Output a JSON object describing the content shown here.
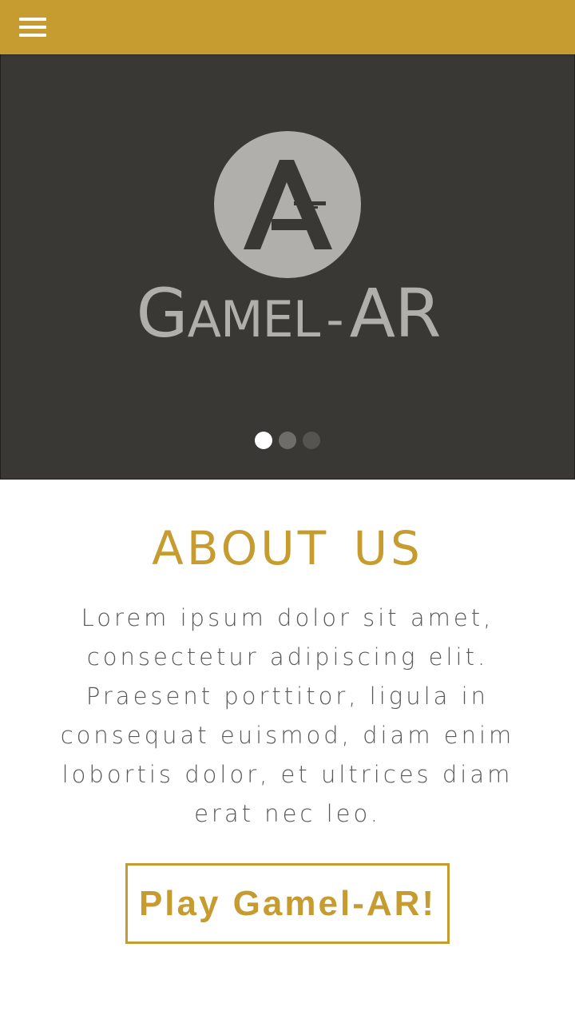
{
  "header": {
    "menu_icon": "hamburger-menu-icon",
    "background_color": "#c69c30"
  },
  "hero": {
    "logo_text_big_1": "G",
    "logo_text_small": "AMEL",
    "logo_text_dash": "-",
    "logo_text_big_2": "AR",
    "background_color": "#393834",
    "carousel": {
      "slide_count": 3,
      "active_index": 0
    }
  },
  "about": {
    "title": "ABOUT US",
    "body": "Lorem ipsum dolor sit amet, consectetur adipiscing elit. Praesent porttitor, ligula in consequat euismod, diam enim lobortis dolor, et ultrices diam erat nec leo.",
    "accent_color": "#c69c30"
  },
  "cta": {
    "label": "Play Gamel-AR!"
  }
}
